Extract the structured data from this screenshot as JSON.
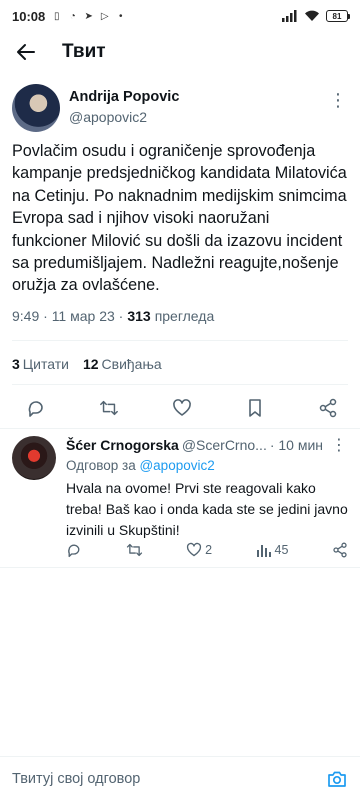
{
  "status_bar": {
    "time": "10:08",
    "battery": "81"
  },
  "header": {
    "title": "Твит"
  },
  "tweet": {
    "display_name": "Andrija Popovic",
    "handle": "@apopovic2",
    "text": "Povlačim osudu i ograničenje sprovođenja kampanje predsjedničkog kandidata Milatovića na Cetinju. Po naknadnim medijskim snimcima Evropa sad i njihov visoki naoružani funkcioner Milović su došli da izazovu incident sa predumišljajem. Nadležni reagujte,nošenje oružja za ovlašćene.",
    "time": "9:49 · 11 мар 23 ·",
    "views_count": "313",
    "views_label": "прегледа",
    "quotes_count": "3",
    "quotes_label": "Цитати",
    "likes_count": "12",
    "likes_label": "Свиђања"
  },
  "reply": {
    "display_name": "Šćer Crnogorska",
    "handle": "@ScerCrno...",
    "time": "· 10 мин",
    "replying_prefix": "Одговор за",
    "replying_to": "@apopovic2",
    "text": "Hvala na ovome! Prvi ste reagovali kako treba! Baš kao i onda kada ste se jedini javno izvinili u Skupštini!",
    "likes": "2",
    "views": "45"
  },
  "composer": {
    "placeholder": "Твитуј свој одговор"
  },
  "colors": {
    "accent": "#1d9bf0",
    "muted": "#536471",
    "text": "#0f1419"
  },
  "icons": [
    "back-arrow-icon",
    "reply-icon",
    "retweet-icon",
    "like-icon",
    "bookmark-icon",
    "share-icon",
    "views-icon",
    "camera-icon"
  ]
}
